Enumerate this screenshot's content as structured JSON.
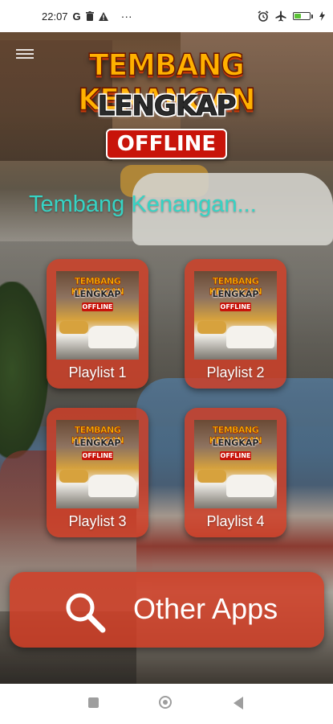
{
  "status_bar": {
    "time": "22:07",
    "left_icons": [
      "g-icon",
      "trash-icon",
      "warning-icon",
      "more-icon"
    ],
    "more": "···",
    "right_icons": [
      "alarm-icon",
      "airplane-icon",
      "battery-icon",
      "charging-icon"
    ],
    "battery_level": 0.46
  },
  "header": {
    "title": "TEMBANG KENANGAN",
    "subtitle": "LENGKAP",
    "badge": "OFFLINE",
    "marquee": "Tembang Kenangan..."
  },
  "thumbnail": {
    "title": "TEMBANG KENANGAN",
    "subtitle": "LENGKAP",
    "badge": "OFFLINE"
  },
  "playlists": [
    {
      "label": "Playlist 1"
    },
    {
      "label": "Playlist 2"
    },
    {
      "label": "Playlist 3"
    },
    {
      "label": "Playlist 4"
    }
  ],
  "other_apps": {
    "label": "Other Apps",
    "icon": "search-icon"
  },
  "colors": {
    "accent": "#d23e26",
    "title_orange": "#ffb100",
    "marquee_teal": "#36d3c4",
    "badge_red": "#c8140a"
  }
}
